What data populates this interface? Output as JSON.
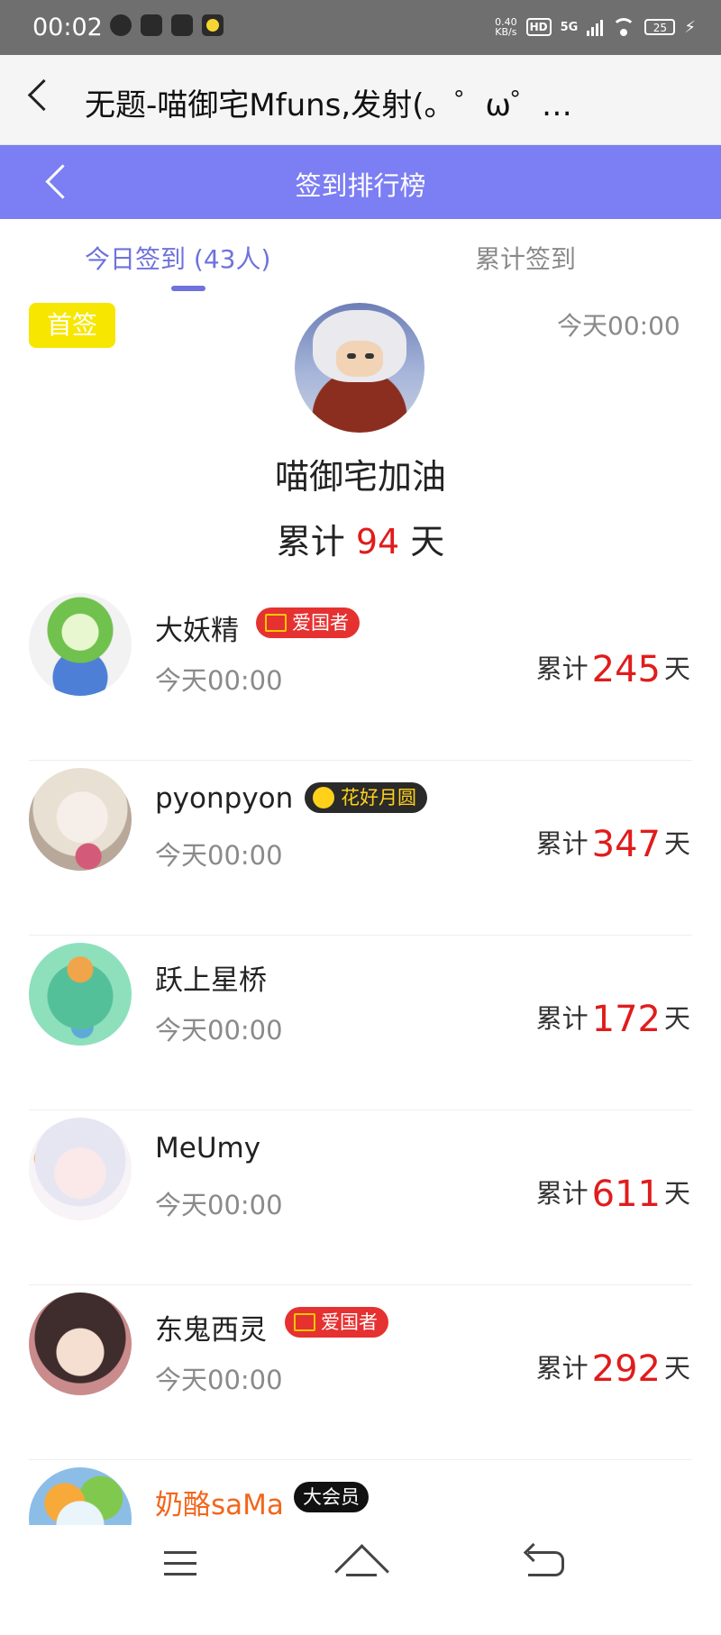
{
  "status_bar": {
    "time": "00:02",
    "net_speed_value": "0.40",
    "net_speed_unit": "KB/s",
    "hd": "HD",
    "network": "5G",
    "battery": "25"
  },
  "browser_bar": {
    "title": "无题-喵御宅Mfuns,发射(。゜ω゜…"
  },
  "header": {
    "title": "签到排行榜"
  },
  "tabs": [
    {
      "label": "今日签到 (43人)",
      "active": true
    },
    {
      "label": "累计签到",
      "active": false
    }
  ],
  "first": {
    "badge": "首签",
    "time": "今天00:00",
    "name": "喵御宅加油",
    "total_prefix": "累计",
    "total_days": "94",
    "total_suffix": "天"
  },
  "list": [
    {
      "name": "大妖精",
      "badge": "爱国者",
      "badge_style": "red",
      "time": "今天00:00",
      "total_prefix": "累计",
      "days": "245",
      "unit": "天"
    },
    {
      "name": "pyonpyon",
      "badge": "花好月圆",
      "badge_style": "dark",
      "time": "今天00:00",
      "total_prefix": "累计",
      "days": "347",
      "unit": "天"
    },
    {
      "name": "跃上星桥",
      "badge": "",
      "badge_style": "",
      "time": "今天00:00",
      "total_prefix": "累计",
      "days": "172",
      "unit": "天"
    },
    {
      "name": "MeUmy",
      "badge": "",
      "badge_style": "",
      "time": "今天00:00",
      "total_prefix": "累计",
      "days": "611",
      "unit": "天"
    },
    {
      "name": "东鬼西灵",
      "badge": "爱国者",
      "badge_style": "red",
      "time": "今天00:00",
      "total_prefix": "累计",
      "days": "292",
      "unit": "天"
    },
    {
      "name": "奶酪saMa",
      "badge": "大会员",
      "badge_style": "black",
      "time": "",
      "total_prefix": "",
      "days": "",
      "unit": ""
    }
  ],
  "colors": {
    "header_bg": "#7c7ef3",
    "accent": "#6f72dc",
    "highlight_red": "#e01c1c",
    "first_badge_bg": "#f7e600",
    "vip_name": "#f2661d"
  }
}
